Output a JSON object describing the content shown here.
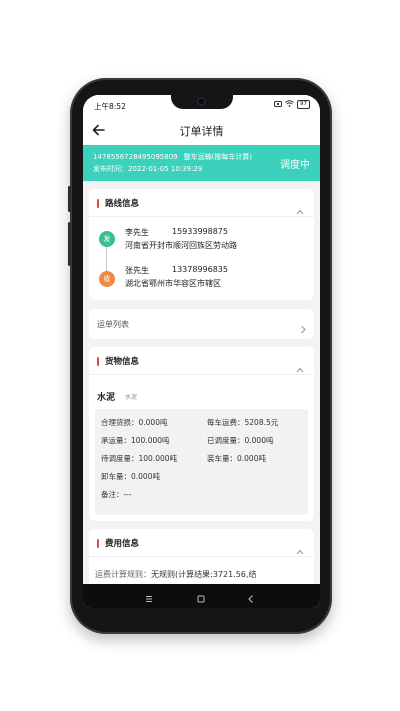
{
  "status_bar": {
    "time": "上午8:52",
    "battery": "97"
  },
  "nav": {
    "title": "订单详情"
  },
  "order": {
    "number": "1478556728495095809",
    "type": "整车运输(按每车计算)",
    "publish_time": "发布时间：2022-01-05 10:39:29",
    "status": "调度中"
  },
  "route": {
    "title": "路线信息",
    "sender": {
      "badge": "发",
      "name": "李先生",
      "phone": "15933998875",
      "address": "河南省开封市顺河回族区劳动路"
    },
    "receiver": {
      "badge": "收",
      "name": "张先生",
      "phone": "13378996835",
      "address": "湖北省鄂州市华容区市辖区"
    }
  },
  "waybill": {
    "title": "运单列表"
  },
  "goods": {
    "title": "货物信息",
    "name": "水泥",
    "sub": "水泥",
    "items": [
      {
        "label": "合理货损：",
        "value": "0.000吨"
      },
      {
        "label": "每车运费：",
        "value": "5208.5元"
      },
      {
        "label": "承运量：",
        "value": "100.000吨"
      },
      {
        "label": "已调度量：",
        "value": "0.000吨"
      },
      {
        "label": "待调度量：",
        "value": "100.000吨"
      },
      {
        "label": "装车量：",
        "value": "0.000吨"
      },
      {
        "label": "卸车量：",
        "value": "0.000吨"
      },
      {
        "label": "备注：",
        "value": "---"
      }
    ]
  },
  "fee": {
    "title": "费用信息",
    "rule_label": "运费计算规则：",
    "rule_value": "无规则(计算结果:3721.56,结"
  },
  "colors": {
    "accent": "#3bd1bd",
    "section_bar": "#e2473f",
    "sender_badge": "#3bbf8f",
    "receiver_badge": "#f08a43"
  }
}
